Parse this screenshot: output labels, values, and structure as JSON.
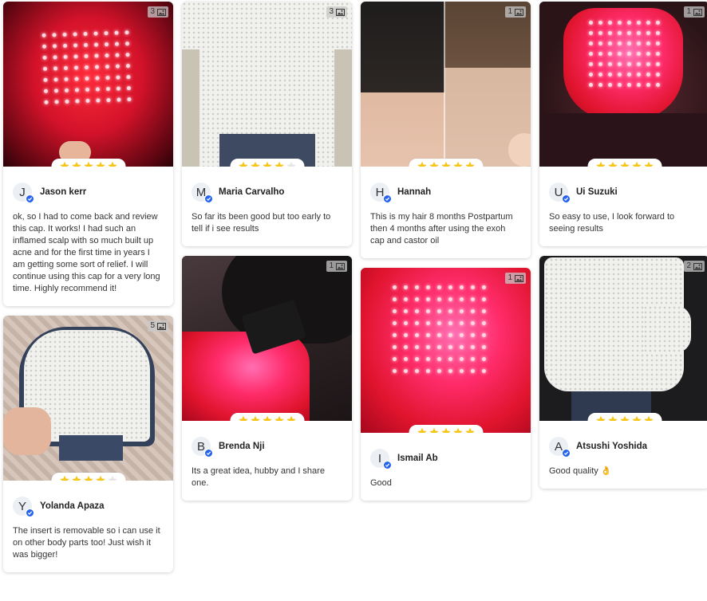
{
  "star_color": "#f5c518",
  "star_empty_color": "#e6e6e6",
  "verified_color": "#2563eb",
  "reviews": [
    {
      "initial": "J",
      "name": "Jason kerr",
      "rating": 5,
      "photo_count": "3",
      "text": "ok, so I had to come back and review this cap. It works! I had such an inflamed scalp with so much built up acne and for the first time in years I am getting some sort of relief. I will continue using this cap for a very long time. Highly recommend it!"
    },
    {
      "initial": "Y",
      "name": "Yolanda Apaza",
      "rating": 4,
      "photo_count": "5",
      "text": "The insert is removable so i can use it on other body parts too! Just wish it was bigger!"
    },
    {
      "initial": "M",
      "name": "Maria Carvalho",
      "rating": 4,
      "photo_count": "3",
      "text": "So far its been good but too early to tell if i see results"
    },
    {
      "initial": "B",
      "name": "Brenda Nji",
      "rating": 5,
      "photo_count": "1",
      "text": "Its a great idea, hubby and I share one."
    },
    {
      "initial": "H",
      "name": "Hannah",
      "rating": 5,
      "photo_count": "1",
      "text": "This is my hair 8 months Postpartum then 4 months after using the exoh cap and castor oil"
    },
    {
      "initial": "I",
      "name": "Ismail Ab",
      "rating": 5,
      "photo_count": "1",
      "text": "Good"
    },
    {
      "initial": "U",
      "name": "Ui Suzuki",
      "rating": 5,
      "photo_count": "1",
      "text": "So easy to use, I look forward to seeing results"
    },
    {
      "initial": "A",
      "name": "Atsushi Yoshida",
      "rating": 5,
      "photo_count": "2",
      "text": "Good quality 👌"
    }
  ]
}
